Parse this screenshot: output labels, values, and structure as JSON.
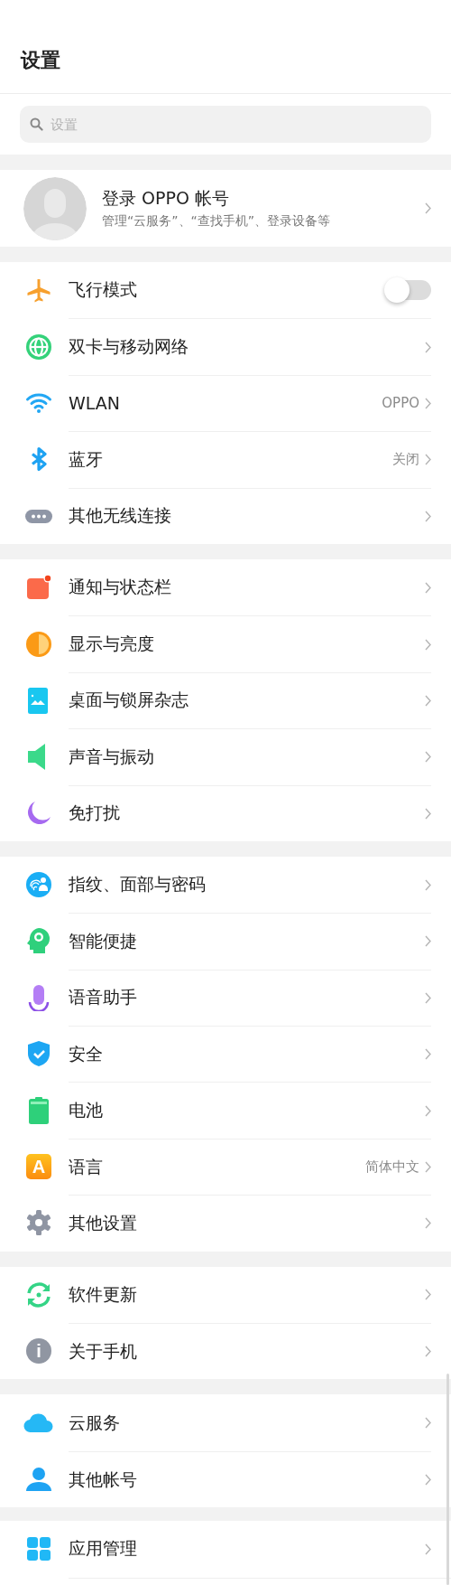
{
  "header": {
    "title": "设置"
  },
  "search": {
    "placeholder": "设置"
  },
  "account": {
    "title": "登录 OPPO 帐号",
    "subtitle": "管理“云服务”、“查找手机”、登录设备等"
  },
  "sections": [
    {
      "items": [
        {
          "kind": "toggle",
          "label": "飞行模式",
          "on": false
        },
        {
          "kind": "link",
          "label": "双卡与移动网络"
        },
        {
          "kind": "link",
          "label": "WLAN",
          "value": "OPPO"
        },
        {
          "kind": "link",
          "label": "蓝牙",
          "value": "关闭"
        },
        {
          "kind": "link",
          "label": "其他无线连接"
        }
      ]
    },
    {
      "items": [
        {
          "kind": "link",
          "label": "通知与状态栏"
        },
        {
          "kind": "link",
          "label": "显示与亮度"
        },
        {
          "kind": "link",
          "label": "桌面与锁屏杂志"
        },
        {
          "kind": "link",
          "label": "声音与振动"
        },
        {
          "kind": "link",
          "label": "免打扰"
        }
      ]
    },
    {
      "items": [
        {
          "kind": "link",
          "label": "指纹、面部与密码"
        },
        {
          "kind": "link",
          "label": "智能便捷"
        },
        {
          "kind": "link",
          "label": "语音助手"
        },
        {
          "kind": "link",
          "label": "安全"
        },
        {
          "kind": "link",
          "label": "电池"
        },
        {
          "kind": "link",
          "label": "语言",
          "value": "简体中文",
          "icon_text": "A"
        },
        {
          "kind": "link",
          "label": "其他设置"
        }
      ]
    },
    {
      "items": [
        {
          "kind": "link",
          "label": "软件更新"
        },
        {
          "kind": "link",
          "label": "关于手机",
          "icon_text": "i"
        }
      ]
    },
    {
      "items": [
        {
          "kind": "link",
          "label": "云服务"
        },
        {
          "kind": "link",
          "label": "其他帐号"
        }
      ]
    },
    {
      "items": [
        {
          "kind": "link",
          "label": "应用管理"
        }
      ]
    }
  ]
}
